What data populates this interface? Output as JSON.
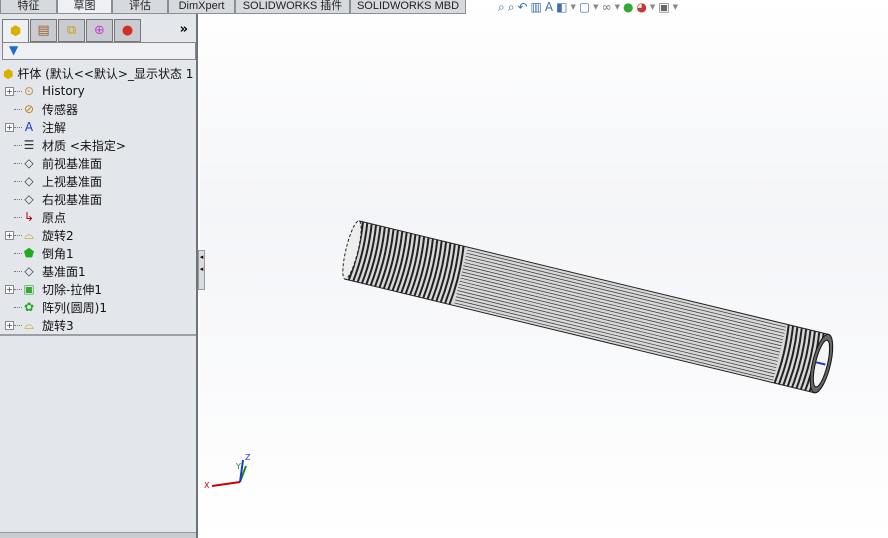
{
  "tabs": [
    "特征",
    "草图",
    "评估",
    "DimXpert",
    "SOLIDWORKS 插件",
    "SOLIDWORKS MBD"
  ],
  "active_tab": "草图",
  "panel": {
    "more": "»",
    "root": "杆体  (默认<<默认>_显示状态 1",
    "items": [
      {
        "label": "History",
        "icon": "history-icon",
        "expand": true
      },
      {
        "label": "传感器",
        "icon": "sensor-icon",
        "expand": false
      },
      {
        "label": "注解",
        "icon": "annotation-icon",
        "expand": true
      },
      {
        "label": "材质 <未指定>",
        "icon": "material-icon",
        "expand": false
      },
      {
        "label": "前视基准面",
        "icon": "plane-icon",
        "expand": false
      },
      {
        "label": "上视基准面",
        "icon": "plane-icon",
        "expand": false
      },
      {
        "label": "右视基准面",
        "icon": "plane-icon",
        "expand": false
      },
      {
        "label": "原点",
        "icon": "origin-icon",
        "expand": false
      },
      {
        "label": "旋转2",
        "icon": "revolve-icon",
        "expand": true
      },
      {
        "label": "倒角1",
        "icon": "chamfer-icon",
        "expand": false
      },
      {
        "label": "基准面1",
        "icon": "plane-icon",
        "expand": false
      },
      {
        "label": "切除-拉伸1",
        "icon": "cut-extrude-icon",
        "expand": true
      },
      {
        "label": "阵列(圆周)1",
        "icon": "circular-pattern-icon",
        "expand": false
      },
      {
        "label": "旋转3",
        "icon": "revolve-icon",
        "expand": true
      }
    ]
  },
  "triad": {
    "x": "X",
    "y": "Y",
    "z": "Z"
  }
}
